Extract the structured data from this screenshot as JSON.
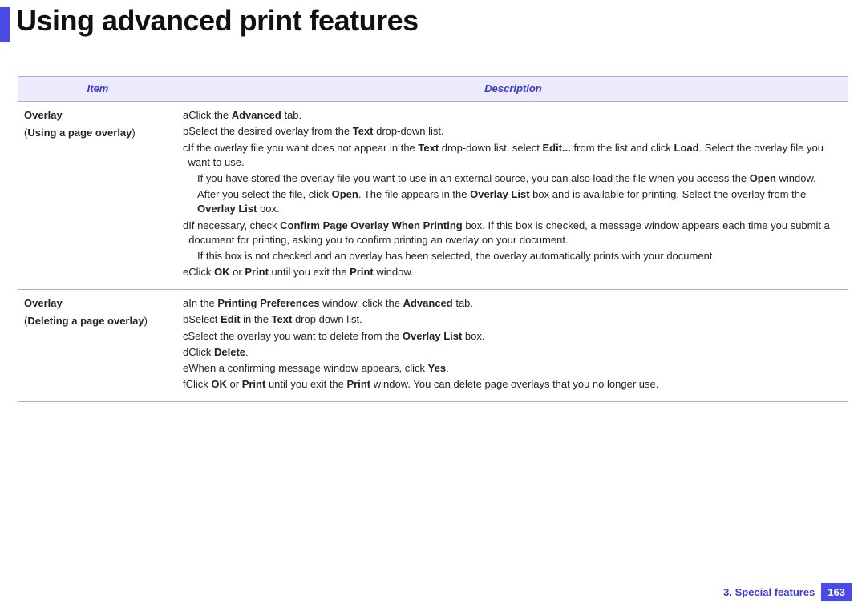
{
  "title": "Using advanced print features",
  "headers": {
    "item": "Item",
    "description": "Description"
  },
  "rows": [
    {
      "item_title": "Overlay",
      "item_sub": "Using a page overlay",
      "steps": [
        {
          "l": "a",
          "html": "Click the <b>Advanced</b> tab."
        },
        {
          "l": "b",
          "html": "Select the desired overlay from the <b>Text</b> drop-down list."
        },
        {
          "l": "c",
          "html": "If the overlay file you want does not appear in the <b>Text</b> drop-down list, select <b>Edit...</b> from the list and click <b>Load</b>. Select the overlay file you want to use."
        },
        {
          "cont": true,
          "html": "If you have stored the overlay file you want to use in an external source, you can also load the file when you access the <b>Open</b> window."
        },
        {
          "cont": true,
          "html": "After you select the file, click <b>Open</b>. The file appears in the <b>Overlay List</b> box and is available for printing. Select the overlay from the <b>Overlay List</b> box."
        },
        {
          "l": "d",
          "html": "If necessary, check <b>Confirm Page Overlay When Printing</b> box. If this box is checked, a message window appears each time you submit a document for printing, asking you to confirm printing an overlay on your document."
        },
        {
          "cont": true,
          "html": "If this box is not checked and an overlay has been selected, the overlay automatically prints with your document."
        },
        {
          "l": "e",
          "html": "Click <b>OK</b> or <b>Print</b> until you exit the <b>Print</b> window."
        }
      ]
    },
    {
      "item_title": "Overlay",
      "item_sub": "Deleting a page overlay",
      "steps": [
        {
          "l": "a",
          "html": "In the <b>Printing Preferences</b> window, click the <b>Advanced</b> tab."
        },
        {
          "l": "b",
          "html": "Select <b>Edit</b> in the <b>Text</b> drop down list."
        },
        {
          "l": "c",
          "html": "Select the overlay you want to delete from the <b>Overlay List</b> box."
        },
        {
          "l": "d",
          "html": "Click <b>Delete</b>."
        },
        {
          "l": "e",
          "html": "When a confirming message window appears, click <b>Yes</b>."
        },
        {
          "l": "f",
          "html": "Click <b>OK</b> or <b>Print</b> until you exit the <b>Print</b> window. You can delete page overlays that you no longer use."
        }
      ]
    }
  ],
  "footer": {
    "chapter": "3.  Special features",
    "page": "163"
  }
}
